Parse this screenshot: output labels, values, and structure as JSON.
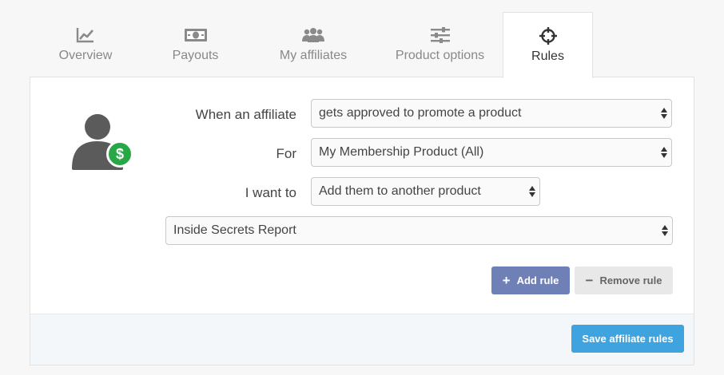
{
  "tabs": [
    {
      "label": "Overview",
      "icon": "line-chart-icon",
      "active": false
    },
    {
      "label": "Payouts",
      "icon": "money-icon",
      "active": false
    },
    {
      "label": "My affiliates",
      "icon": "users-icon",
      "active": false
    },
    {
      "label": "Product options",
      "icon": "sliders-icon",
      "active": false
    },
    {
      "label": "Rules",
      "icon": "crosshairs-icon",
      "active": true
    }
  ],
  "rule": {
    "trigger_label": "When an affiliate",
    "trigger_value": "gets approved to promote a product",
    "for_label": "For",
    "for_value": "My Membership Product (All)",
    "action_label": "I want to",
    "action_value": "Add them to another product",
    "target_value": "Inside Secrets Report",
    "avatar_badge": "$"
  },
  "buttons": {
    "add_icon": "+",
    "add_rule": "Add rule",
    "remove_icon": "−",
    "remove_rule": "Remove rule",
    "save": "Save affiliate rules"
  },
  "colors": {
    "add_button": "#6f80b7",
    "save_button": "#3fa3e0",
    "badge_green": "#27a745",
    "avatar_gray": "#5b5b5b"
  }
}
